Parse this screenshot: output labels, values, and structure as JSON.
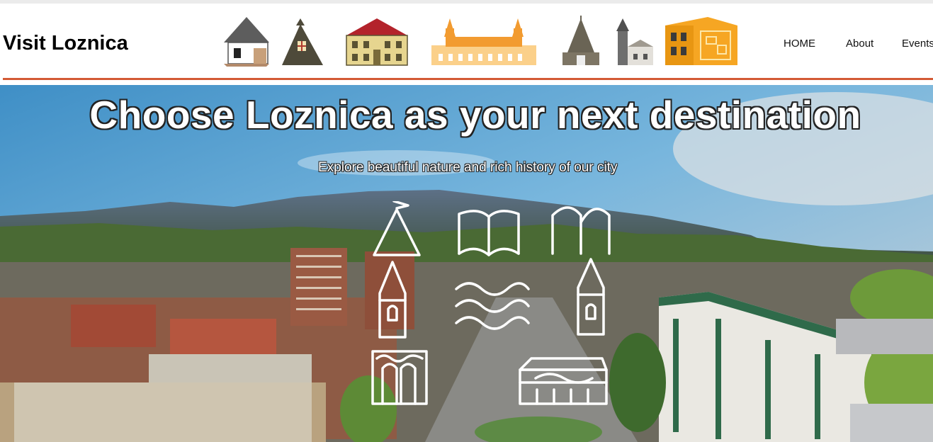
{
  "site": {
    "logo_text": "Visit Loznica"
  },
  "landmarks": [
    {
      "name": "cottage-icon"
    },
    {
      "name": "monument-icon"
    },
    {
      "name": "town-hall-icon"
    },
    {
      "name": "palace-icon"
    },
    {
      "name": "church-icon"
    },
    {
      "name": "tower-church-icon"
    },
    {
      "name": "modern-building-icon"
    }
  ],
  "nav": {
    "items": [
      "HOME",
      "About",
      "Events"
    ]
  },
  "hero": {
    "title": "Choose Loznica as your next destination",
    "subtitle": "Explore beautiful nature and rich history of our city"
  },
  "colors": {
    "accent_rule": "#d35a35",
    "sky": "#5da6d3",
    "emblem_stroke": "#ffffff"
  }
}
